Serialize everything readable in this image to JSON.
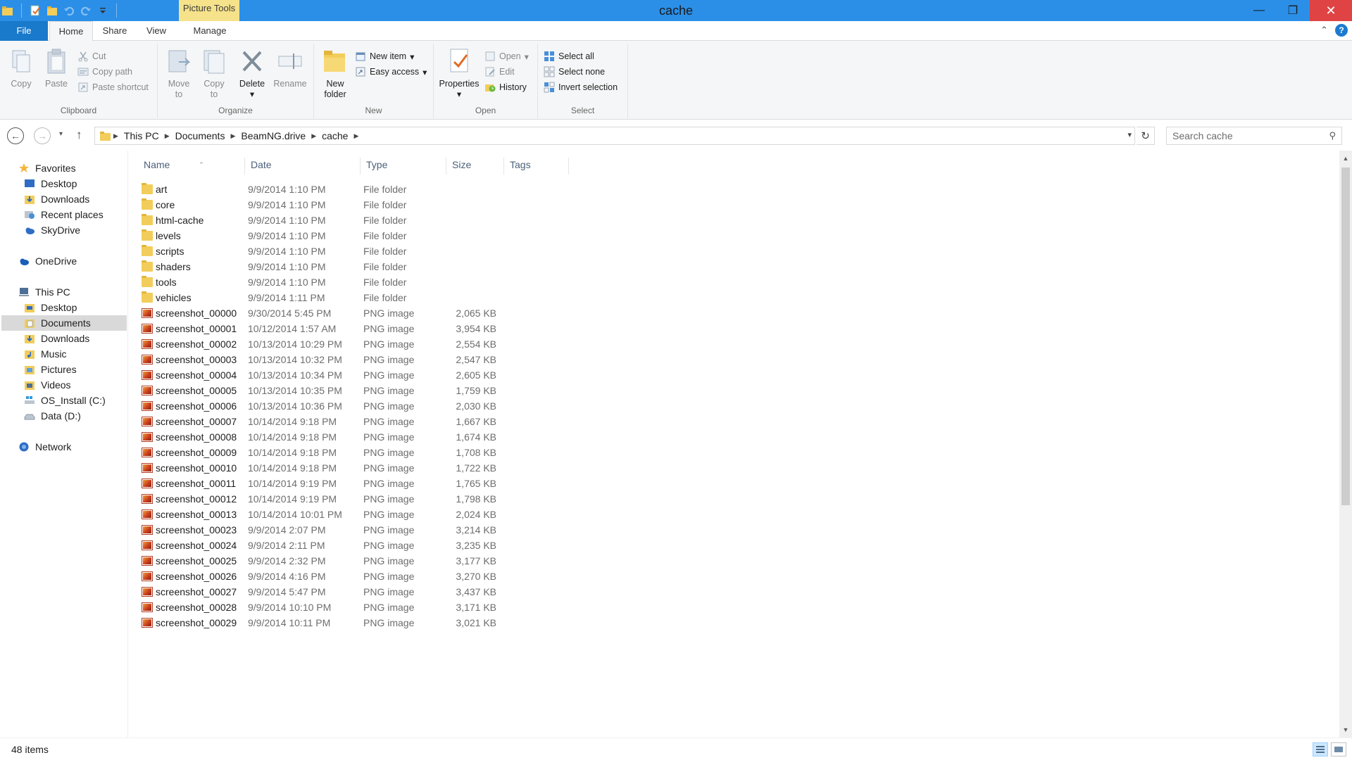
{
  "window": {
    "title": "cache",
    "context_tab": "Picture Tools",
    "controls": {
      "minimize": "—",
      "restore": "❐",
      "close": "✕"
    }
  },
  "tabs": {
    "file": "File",
    "home": "Home",
    "share": "Share",
    "view": "View",
    "manage": "Manage"
  },
  "ribbon": {
    "clipboard": {
      "label": "Clipboard",
      "copy": "Copy",
      "paste": "Paste",
      "cut": "Cut",
      "copy_path": "Copy path",
      "paste_shortcut": "Paste shortcut"
    },
    "organize": {
      "label": "Organize",
      "move_to_1": "Move",
      "move_to_2": "to",
      "copy_to_1": "Copy",
      "copy_to_2": "to",
      "delete": "Delete",
      "rename": "Rename"
    },
    "new": {
      "label": "New",
      "new_folder_1": "New",
      "new_folder_2": "folder",
      "new_item": "New item",
      "easy_access": "Easy access"
    },
    "open": {
      "label": "Open",
      "properties": "Properties",
      "open": "Open",
      "edit": "Edit",
      "history": "History"
    },
    "select": {
      "label": "Select",
      "select_all": "Select all",
      "select_none": "Select none",
      "invert_selection": "Invert selection"
    }
  },
  "address": {
    "crumbs": [
      "This PC",
      "Documents",
      "BeamNG.drive",
      "cache"
    ],
    "search_placeholder": "Search cache"
  },
  "nav": {
    "favorites": "Favorites",
    "fav_desktop": "Desktop",
    "fav_downloads": "Downloads",
    "fav_recent": "Recent places",
    "fav_skydrive": "SkyDrive",
    "onedrive": "OneDrive",
    "thispc": "This PC",
    "pc_desktop": "Desktop",
    "pc_documents": "Documents",
    "pc_downloads": "Downloads",
    "pc_music": "Music",
    "pc_pictures": "Pictures",
    "pc_videos": "Videos",
    "pc_c": "OS_Install (C:)",
    "pc_d": "Data (D:)",
    "network": "Network"
  },
  "columns": {
    "name": "Name",
    "date": "Date",
    "type": "Type",
    "size": "Size",
    "tags": "Tags"
  },
  "files": [
    {
      "name": "art",
      "date": "9/9/2014 1:10 PM",
      "type": "File folder",
      "size": "",
      "kind": "folder"
    },
    {
      "name": "core",
      "date": "9/9/2014 1:10 PM",
      "type": "File folder",
      "size": "",
      "kind": "folder"
    },
    {
      "name": "html-cache",
      "date": "9/9/2014 1:10 PM",
      "type": "File folder",
      "size": "",
      "kind": "folder"
    },
    {
      "name": "levels",
      "date": "9/9/2014 1:10 PM",
      "type": "File folder",
      "size": "",
      "kind": "folder"
    },
    {
      "name": "scripts",
      "date": "9/9/2014 1:10 PM",
      "type": "File folder",
      "size": "",
      "kind": "folder"
    },
    {
      "name": "shaders",
      "date": "9/9/2014 1:10 PM",
      "type": "File folder",
      "size": "",
      "kind": "folder"
    },
    {
      "name": "tools",
      "date": "9/9/2014 1:10 PM",
      "type": "File folder",
      "size": "",
      "kind": "folder"
    },
    {
      "name": "vehicles",
      "date": "9/9/2014 1:11 PM",
      "type": "File folder",
      "size": "",
      "kind": "folder"
    },
    {
      "name": "screenshot_00000",
      "date": "9/30/2014 5:45 PM",
      "type": "PNG image",
      "size": "2,065 KB",
      "kind": "png"
    },
    {
      "name": "screenshot_00001",
      "date": "10/12/2014 1:57 AM",
      "type": "PNG image",
      "size": "3,954 KB",
      "kind": "png"
    },
    {
      "name": "screenshot_00002",
      "date": "10/13/2014 10:29 PM",
      "type": "PNG image",
      "size": "2,554 KB",
      "kind": "png"
    },
    {
      "name": "screenshot_00003",
      "date": "10/13/2014 10:32 PM",
      "type": "PNG image",
      "size": "2,547 KB",
      "kind": "png"
    },
    {
      "name": "screenshot_00004",
      "date": "10/13/2014 10:34 PM",
      "type": "PNG image",
      "size": "2,605 KB",
      "kind": "png"
    },
    {
      "name": "screenshot_00005",
      "date": "10/13/2014 10:35 PM",
      "type": "PNG image",
      "size": "1,759 KB",
      "kind": "png"
    },
    {
      "name": "screenshot_00006",
      "date": "10/13/2014 10:36 PM",
      "type": "PNG image",
      "size": "2,030 KB",
      "kind": "png"
    },
    {
      "name": "screenshot_00007",
      "date": "10/14/2014 9:18 PM",
      "type": "PNG image",
      "size": "1,667 KB",
      "kind": "png"
    },
    {
      "name": "screenshot_00008",
      "date": "10/14/2014 9:18 PM",
      "type": "PNG image",
      "size": "1,674 KB",
      "kind": "png"
    },
    {
      "name": "screenshot_00009",
      "date": "10/14/2014 9:18 PM",
      "type": "PNG image",
      "size": "1,708 KB",
      "kind": "png"
    },
    {
      "name": "screenshot_00010",
      "date": "10/14/2014 9:18 PM",
      "type": "PNG image",
      "size": "1,722 KB",
      "kind": "png"
    },
    {
      "name": "screenshot_00011",
      "date": "10/14/2014 9:19 PM",
      "type": "PNG image",
      "size": "1,765 KB",
      "kind": "png"
    },
    {
      "name": "screenshot_00012",
      "date": "10/14/2014 9:19 PM",
      "type": "PNG image",
      "size": "1,798 KB",
      "kind": "png"
    },
    {
      "name": "screenshot_00013",
      "date": "10/14/2014 10:01 PM",
      "type": "PNG image",
      "size": "2,024 KB",
      "kind": "png"
    },
    {
      "name": "screenshot_00023",
      "date": "9/9/2014 2:07 PM",
      "type": "PNG image",
      "size": "3,214 KB",
      "kind": "png"
    },
    {
      "name": "screenshot_00024",
      "date": "9/9/2014 2:11 PM",
      "type": "PNG image",
      "size": "3,235 KB",
      "kind": "png"
    },
    {
      "name": "screenshot_00025",
      "date": "9/9/2014 2:32 PM",
      "type": "PNG image",
      "size": "3,177 KB",
      "kind": "png"
    },
    {
      "name": "screenshot_00026",
      "date": "9/9/2014 4:16 PM",
      "type": "PNG image",
      "size": "3,270 KB",
      "kind": "png"
    },
    {
      "name": "screenshot_00027",
      "date": "9/9/2014 5:47 PM",
      "type": "PNG image",
      "size": "3,437 KB",
      "kind": "png"
    },
    {
      "name": "screenshot_00028",
      "date": "9/9/2014 10:10 PM",
      "type": "PNG image",
      "size": "3,171 KB",
      "kind": "png"
    },
    {
      "name": "screenshot_00029",
      "date": "9/9/2014 10:11 PM",
      "type": "PNG image",
      "size": "3,021 KB",
      "kind": "png"
    }
  ],
  "status": {
    "item_count": "48 items"
  },
  "colors": {
    "titlebar": "#2b8fe8",
    "file_tab": "#1979ca",
    "picture_tools": "#f5e28a",
    "close": "#e04343"
  }
}
